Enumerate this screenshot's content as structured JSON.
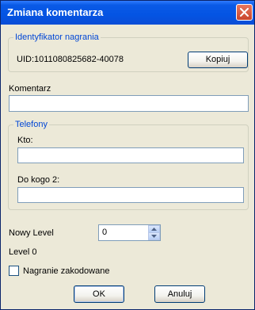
{
  "window": {
    "title": "Zmiana komentarza",
    "close_icon": "close-icon"
  },
  "recording_id": {
    "legend": "Identyfikator nagrania",
    "uid_text": "UID:1011080825682-40078",
    "copy_label": "Kopiuj"
  },
  "comment": {
    "label": "Komentarz",
    "value": ""
  },
  "phones": {
    "legend": "Telefony",
    "who_label": "Kto:",
    "who_value": "",
    "to_whom_label": "Do kogo 2:",
    "to_whom_value": ""
  },
  "level": {
    "new_level_label": "Nowy Level",
    "new_level_value": "0",
    "current_level_text": "Level 0"
  },
  "encoded": {
    "label": "Nagranie zakodowane",
    "checked": false
  },
  "buttons": {
    "ok_label": "OK",
    "cancel_label": "Anuluj"
  },
  "colors": {
    "titlebar": "#0454e3",
    "accent_text": "#0046d5",
    "background": "#ece9d8"
  }
}
